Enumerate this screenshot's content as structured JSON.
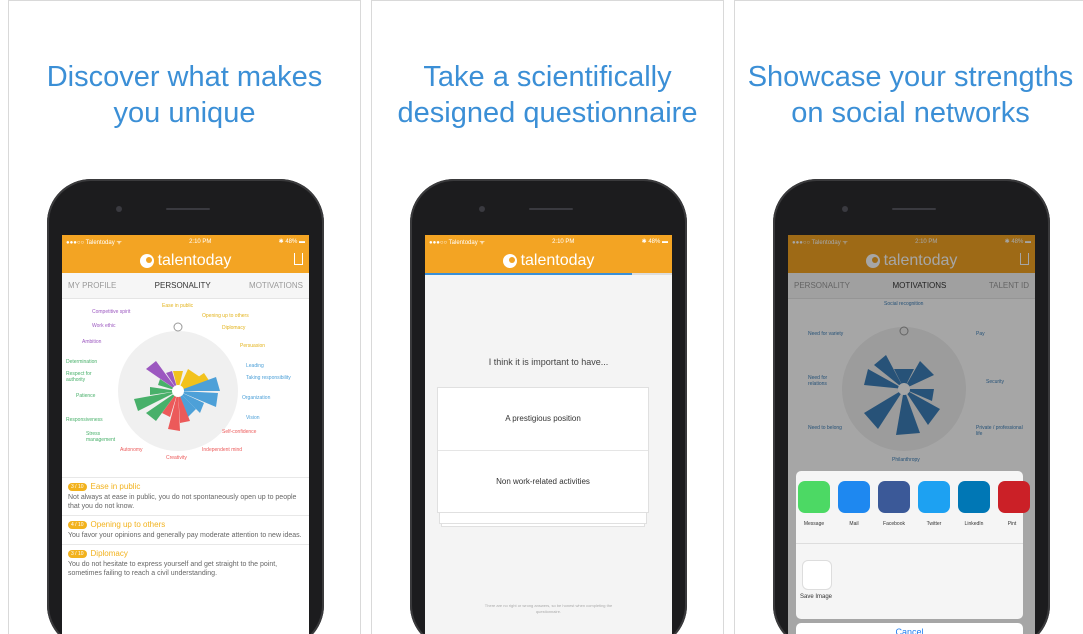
{
  "panels": [
    {
      "headline": [
        "Discover what makes",
        "you unique"
      ]
    },
    {
      "headline": [
        "Take a scientifically",
        "designed questionnaire"
      ]
    },
    {
      "headline": [
        "Showcase your strengths",
        "on social networks"
      ]
    }
  ],
  "status": {
    "left": "●●●○○ Talentoday ᯤ",
    "time": "2:10 PM",
    "right": "✱ 48% ▬",
    "left2": "●●●○○ Talentoday ᯤ"
  },
  "app_name": "talentoday",
  "screen1": {
    "tabs": [
      "MY PROFILE",
      "PERSONALITY",
      "MOTIVATIONS"
    ],
    "radar_labels": {
      "ease": "Ease in public",
      "opening": "Opening up to others",
      "diplomacy": "Diplomacy",
      "persuasion": "Persuasion",
      "leading": "Leading",
      "taking": "Taking responsibility",
      "organization": "Organization",
      "vision": "Vision",
      "selfconf": "Self-confidence",
      "indep": "Independent mind",
      "creativity": "Creativity",
      "autonomy": "Autonomy",
      "stress": "Stress management",
      "respons": "Responsiveness",
      "patience": "Patience",
      "respect": "Respect for authority",
      "determination": "Determination",
      "ambition": "Ambition",
      "workethic": "Work ethic",
      "competitive": "Competitive spirit"
    },
    "items": [
      {
        "badge": "3 / 10",
        "title": "Ease in public",
        "body": "Not always at ease in public, you do not spontaneously open up to people that you do not know."
      },
      {
        "badge": "4 / 10",
        "title": "Opening up to others",
        "body": "You favor your opinions and generally pay moderate attention to new ideas."
      },
      {
        "badge": "3 / 10",
        "title": "Diplomacy",
        "body": "You do not hesitate to express yourself and get straight to the point, sometimes failing to reach a civil understanding."
      }
    ]
  },
  "screen2": {
    "question": "I think it is important to have...",
    "answers": [
      "A prestigious position",
      "Non work-related activities"
    ],
    "footer": "There are no right or wrong answers, so be honest when completing the questionnaire."
  },
  "screen3": {
    "tabs": [
      "PERSONALITY",
      "MOTIVATIONS",
      "TALENT ID"
    ],
    "radar_labels": {
      "social": "Social recognition",
      "pay": "Pay",
      "security": "Security",
      "private": "Private / professional life",
      "philanthropy": "Philanthropy",
      "belong": "Need to belong",
      "relations": "Need for relations",
      "variety": "Need for variety"
    },
    "share_apps": [
      {
        "name": "Message",
        "icon": "message-icon",
        "color": "#4cd964"
      },
      {
        "name": "Mail",
        "icon": "mail-icon",
        "color": "#1e88f0"
      },
      {
        "name": "Facebook",
        "icon": "facebook-icon",
        "color": "#3b5998"
      },
      {
        "name": "Twitter",
        "icon": "twitter-icon",
        "color": "#1da1f2"
      },
      {
        "name": "LinkedIn",
        "icon": "linkedin-icon",
        "color": "#0077b5"
      },
      {
        "name": "Pint",
        "icon": "pinterest-icon",
        "color": "#cb2027"
      }
    ],
    "save_image": "Save Image",
    "cancel": "Cancel"
  },
  "colors": {
    "brand": "#f3a423",
    "headline": "#3b8fd6"
  }
}
